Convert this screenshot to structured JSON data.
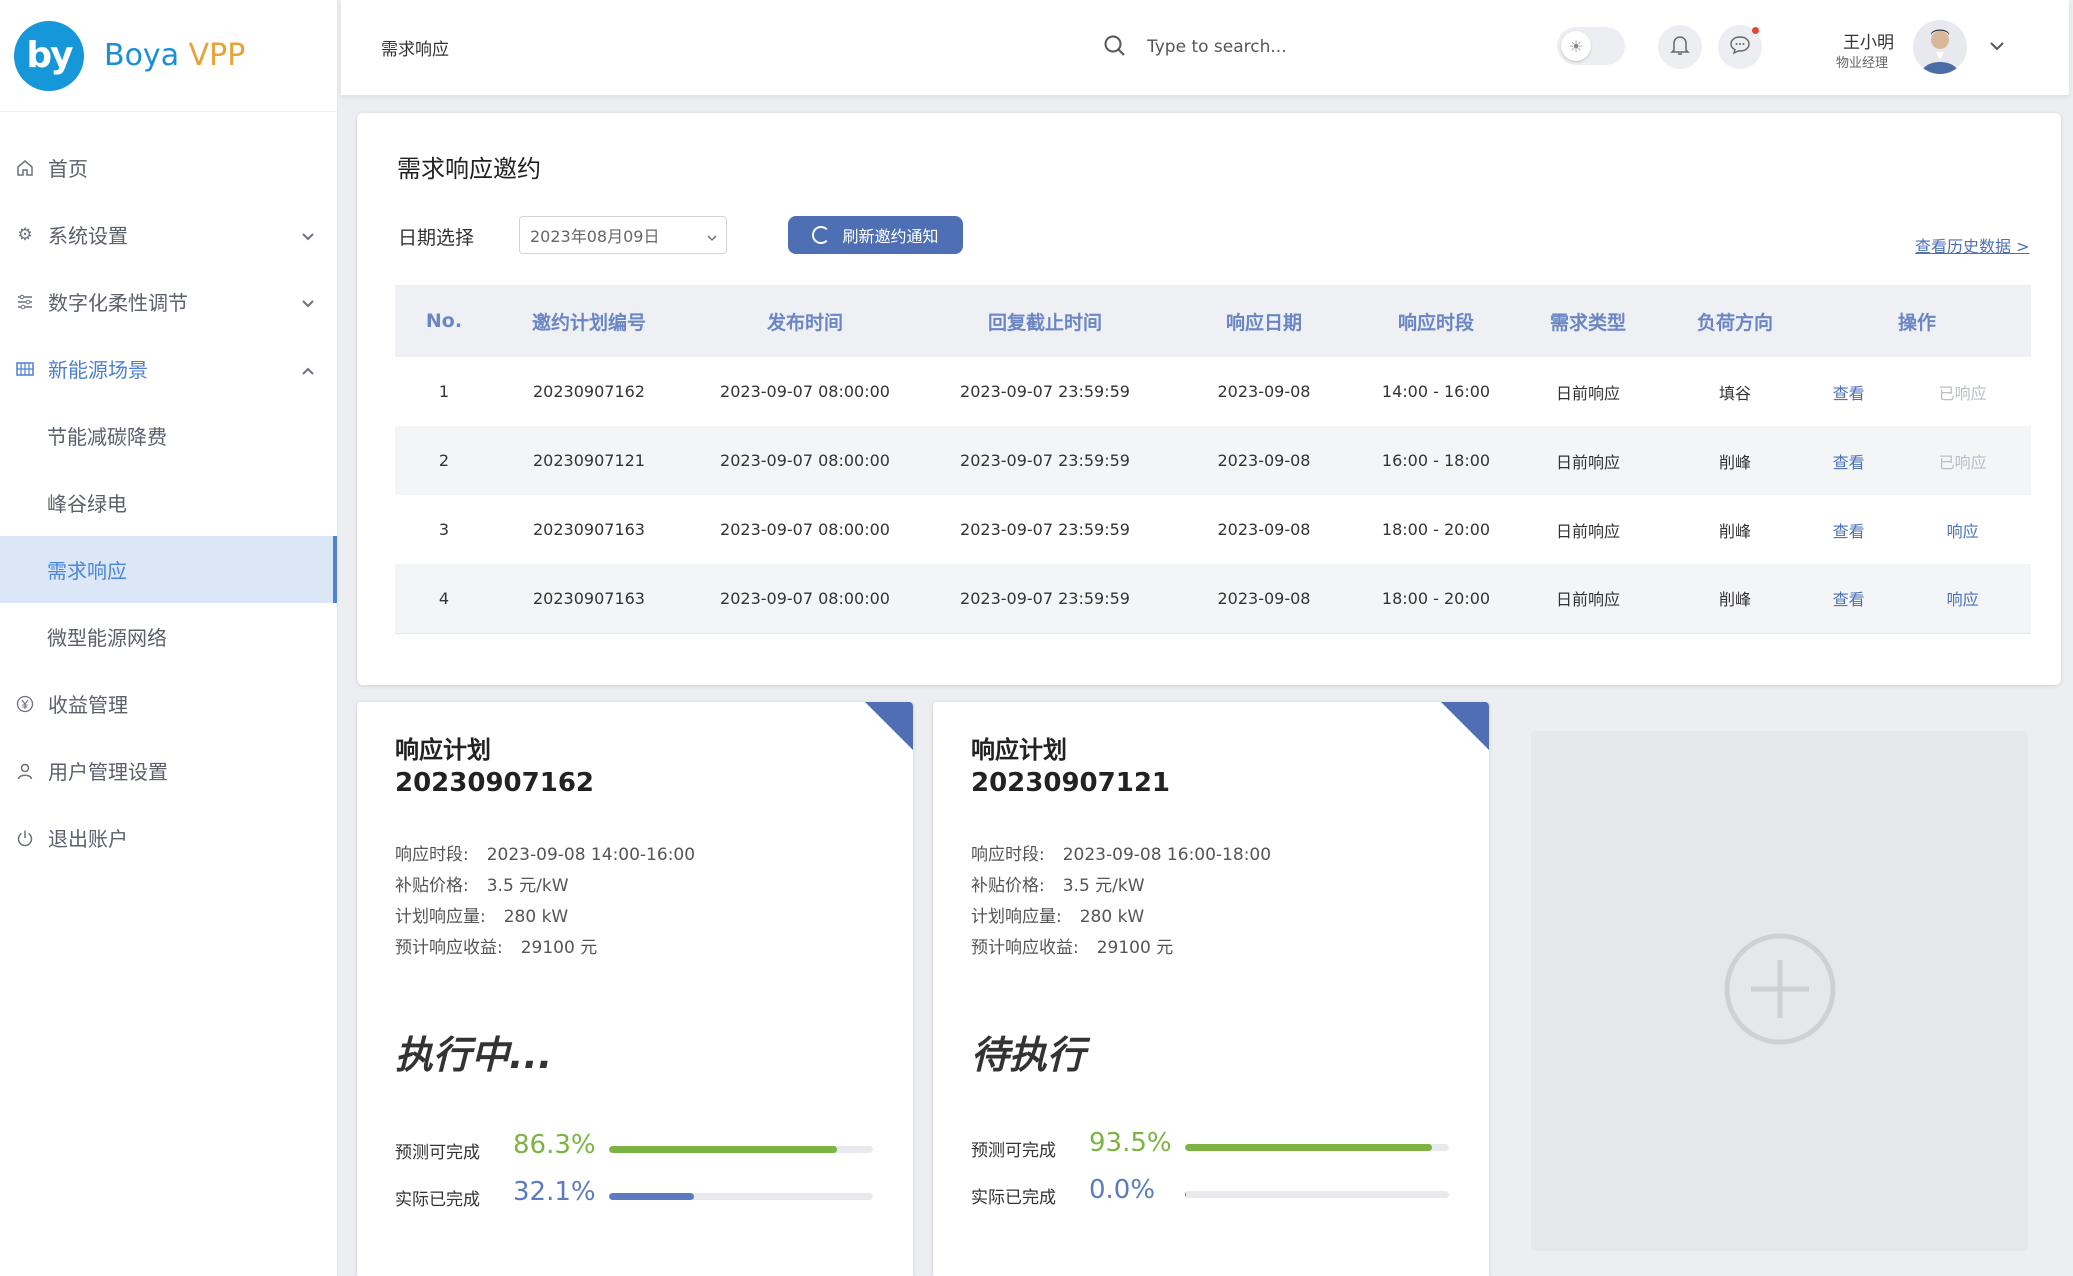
{
  "brand": {
    "logo_mark": "by",
    "name": "Boya",
    "suffix": "VPP"
  },
  "sidebar": {
    "items": [
      {
        "label": "首页",
        "icon": "home-icon"
      },
      {
        "label": "系统设置",
        "icon": "gear-icon"
      },
      {
        "label": "数字化柔性调节",
        "icon": "sliders-icon"
      },
      {
        "label": "新能源场景",
        "icon": "grid-icon"
      },
      {
        "label": "节能减碳降费"
      },
      {
        "label": "峰谷绿电"
      },
      {
        "label": "需求响应"
      },
      {
        "label": "微型能源网络"
      },
      {
        "label": "收益管理",
        "icon": "yen-icon"
      },
      {
        "label": "用户管理设置",
        "icon": "user-icon"
      },
      {
        "label": "退出账户",
        "icon": "power-icon"
      }
    ]
  },
  "header": {
    "crumb": "需求响应",
    "search_placeholder": "Type to search...",
    "user_name": "王小明",
    "user_role": "物业经理"
  },
  "invite": {
    "title": "需求响应邀约",
    "date_label": "日期选择",
    "date_value": "2023年08月09日",
    "refresh_label": "刷新邀约通知",
    "history_link": "查看历史数据 >",
    "columns": [
      "No.",
      "邀约计划编号",
      "发布时间",
      "回复截止时间",
      "响应日期",
      "响应时段",
      "需求类型",
      "负荷方向",
      "操作"
    ],
    "rows": [
      {
        "no": "1",
        "plan": "20230907162",
        "publish": "2023-09-07  08:00:00",
        "deadline": "2023-09-07  23:59:59",
        "date": "2023-09-08",
        "slot": "14:00 - 16:00",
        "type": "日前响应",
        "direction": "填谷",
        "view": "查看",
        "action": "已响应"
      },
      {
        "no": "2",
        "plan": "20230907121",
        "publish": "2023-09-07  08:00:00",
        "deadline": "2023-09-07  23:59:59",
        "date": "2023-09-08",
        "slot": "16:00 - 18:00",
        "type": "日前响应",
        "direction": "削峰",
        "view": "查看",
        "action": "已响应"
      },
      {
        "no": "3",
        "plan": "20230907163",
        "publish": "2023-09-07  08:00:00",
        "deadline": "2023-09-07  23:59:59",
        "date": "2023-09-08",
        "slot": "18:00 - 20:00",
        "type": "日前响应",
        "direction": "削峰",
        "view": "查看",
        "action": "响应"
      },
      {
        "no": "4",
        "plan": "20230907163",
        "publish": "2023-09-07  08:00:00",
        "deadline": "2023-09-07  23:59:59",
        "date": "2023-09-08",
        "slot": "18:00 - 20:00",
        "type": "日前响应",
        "direction": "削峰",
        "view": "查看",
        "action": "响应"
      }
    ]
  },
  "plans": [
    {
      "title": "响应计划",
      "id": "20230907162",
      "slot_label": "响应时段:",
      "slot": "2023-09-08   14:00-16:00",
      "price_label": "补贴价格:",
      "price": "3.5 元/kW",
      "volume_label": "计划响应量:",
      "volume": "280 kW",
      "revenue_label": "预计响应收益:",
      "revenue": "29100 元",
      "status": "执行中...",
      "forecast_label": "预测可完成",
      "forecast": "86.3%",
      "forecast_value": 86.3,
      "actual_label": "实际已完成",
      "actual": "32.1%",
      "actual_value": 32.1
    },
    {
      "title": "响应计划",
      "id": "20230907121",
      "slot_label": "响应时段:",
      "slot": "2023-09-08   16:00-18:00",
      "price_label": "补贴价格:",
      "price": "3.5 元/kW",
      "volume_label": "计划响应量:",
      "volume": "280 kW",
      "revenue_label": "预计响应收益:",
      "revenue": "29100 元",
      "status": "待执行",
      "forecast_label": "预测可完成",
      "forecast": "93.5%",
      "forecast_value": 93.5,
      "actual_label": "实际已完成",
      "actual": "0.0%",
      "actual_value": 0.0
    }
  ],
  "colors": {
    "accent": "#4f6fb5",
    "brand": "#1597d9",
    "progress_green": "#7cb342",
    "progress_blue": "#5a7bbf",
    "active_bg": "#dbe7f7"
  }
}
